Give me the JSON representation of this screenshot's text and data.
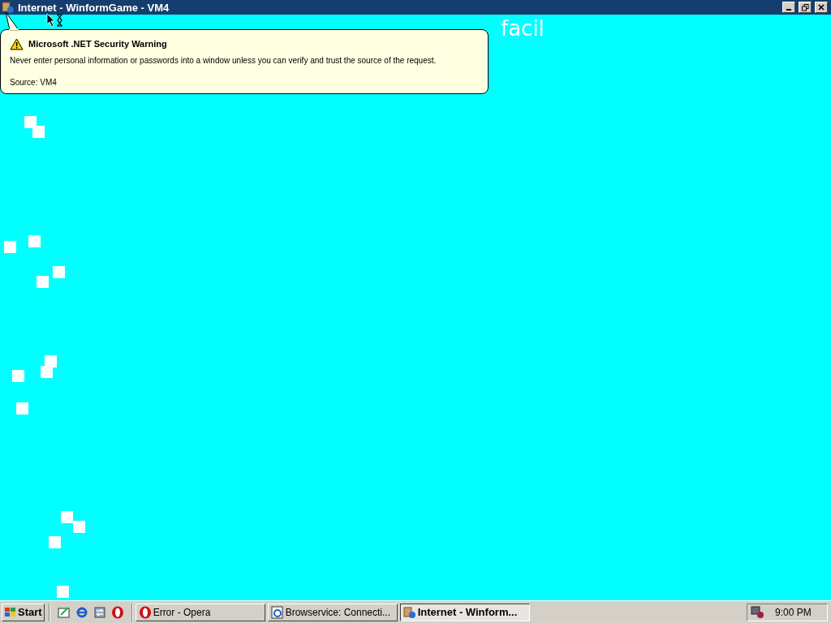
{
  "window": {
    "title": "Internet - WinformGame - VM4"
  },
  "game": {
    "caption": "facil"
  },
  "balloon": {
    "title": "Microsoft .NET Security Warning",
    "message": "Never enter personal information or passwords into a window unless you can verify and trust the source of the request.",
    "source": "Source: VM4"
  },
  "taskbar": {
    "start": "Start",
    "tasks": [
      {
        "label": "Error - Opera",
        "kind": "opera",
        "selected": false
      },
      {
        "label": "Browservice: Connecti...",
        "kind": "ie",
        "selected": false
      },
      {
        "label": "Internet - Winform...",
        "kind": "app",
        "selected": true
      }
    ],
    "clock": "9:00 PM"
  }
}
